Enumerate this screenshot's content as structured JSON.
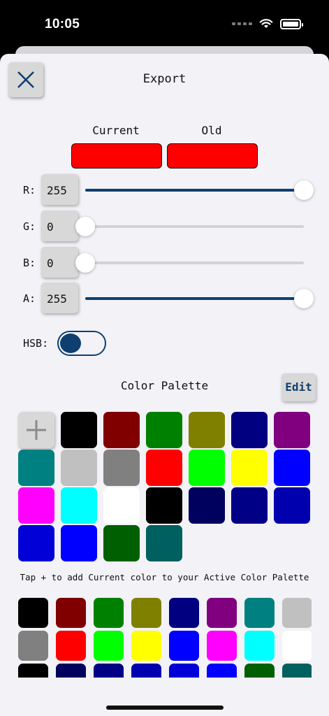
{
  "status": {
    "time": "10:05"
  },
  "header": {
    "title": "Export"
  },
  "compare": {
    "current_label": "Current",
    "old_label": "Old",
    "current_color": "#ff0000",
    "old_color": "#ff0000"
  },
  "sliders": [
    {
      "label": "R:",
      "value": "255",
      "max": 255
    },
    {
      "label": "G:",
      "value": "0",
      "max": 255
    },
    {
      "label": "B:",
      "value": "0",
      "max": 255
    },
    {
      "label": "A:",
      "value": "255",
      "max": 255
    }
  ],
  "hsb": {
    "label": "HSB:",
    "on": false
  },
  "palette": {
    "title": "Color Palette",
    "edit_label": "Edit",
    "active_colors": [
      "#000000",
      "#800000",
      "#008000",
      "#808000",
      "#000080",
      "#800080",
      "#008080",
      "#c0c0c0",
      "#808080",
      "#ff0000",
      "#00ff00",
      "#ffff00",
      "#0000ff",
      "#ff00ff",
      "#00ffff",
      "#ffffff",
      "#000000",
      "#00005f",
      "#000087",
      "#0000af",
      "#0000d7",
      "#0000ff",
      "#005f00",
      "#005f5f"
    ],
    "hint": "Tap + to add Current color to your Active Color Palette",
    "all_colors": [
      "#000000",
      "#800000",
      "#008000",
      "#808000",
      "#000080",
      "#800080",
      "#008080",
      "#c0c0c0",
      "#808080",
      "#ff0000",
      "#00ff00",
      "#ffff00",
      "#0000ff",
      "#ff00ff",
      "#00ffff",
      "#ffffff",
      "#000000",
      "#00005f",
      "#000087",
      "#0000af",
      "#0000d7",
      "#0000ff",
      "#005f00",
      "#005f5f"
    ]
  },
  "icons": {
    "close": "close-x-icon",
    "add": "plus-icon",
    "wifi": "wifi-icon",
    "battery": "battery-icon"
  }
}
